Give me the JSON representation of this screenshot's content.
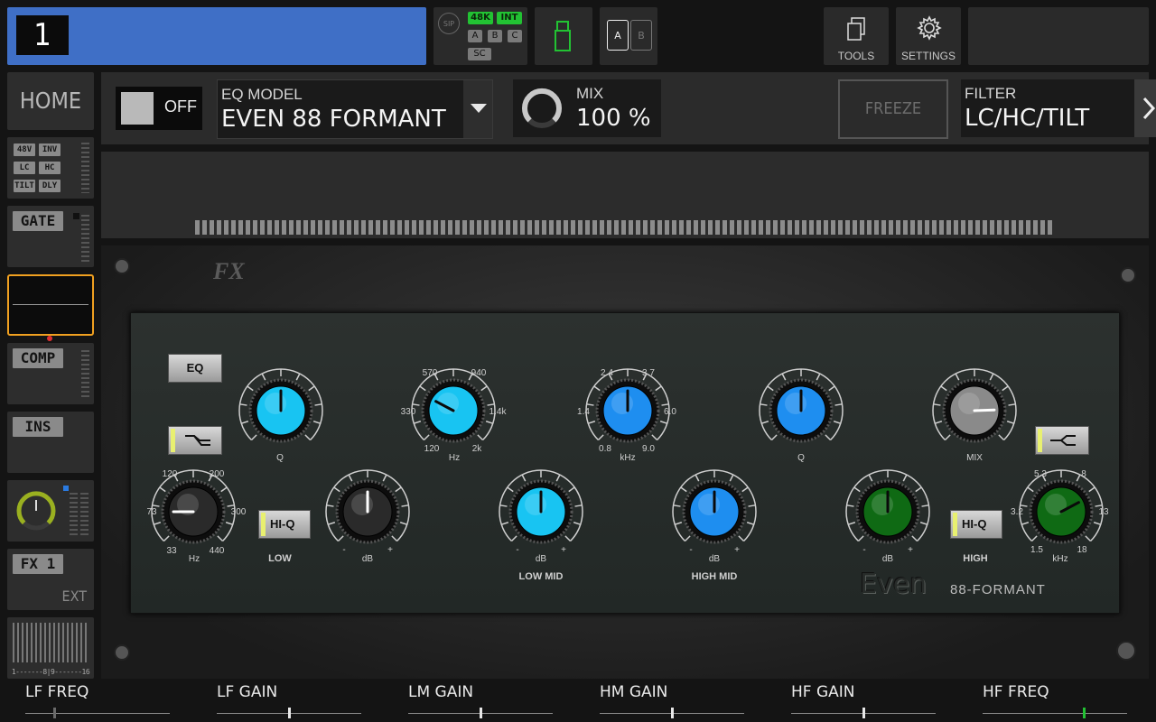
{
  "topbar": {
    "channel_number": "1",
    "sip_label": "SIP",
    "tags": {
      "sr": "48K",
      "clock": "INT",
      "a": "A",
      "b": "B",
      "c": "C",
      "sc": "SC"
    },
    "ab_a": "A",
    "ab_b": "B",
    "tools_label": "TOOLS",
    "settings_label": "SETTINGS"
  },
  "sidebar": {
    "home_label": "HOME",
    "config_tags": [
      "48V",
      "INV",
      "LC",
      "HC",
      "TILT",
      "DLY"
    ],
    "gate_label": "GATE",
    "comp_label": "COMP",
    "ins_label": "INS",
    "fx_label": "FX 1",
    "fx_sub": "EXT",
    "meter_scale": "1-------8|9-------16"
  },
  "header": {
    "on_off_label": "OFF",
    "eq_model_label": "EQ MODEL",
    "eq_model_value": "EVEN 88 FORMANT",
    "mix_label": "MIX",
    "mix_value": "100 %",
    "mix_level": 1.0,
    "freeze_label": "FREEZE",
    "filter_label": "FILTER",
    "filter_value": "LC/HC/TILT"
  },
  "plugin": {
    "logo": "FX",
    "brand": "Even",
    "model": "88-FORMANT",
    "eq_button": "EQ",
    "hiq_label": "HI-Q",
    "low_freq_ticks": [
      "120",
      "200",
      "73",
      "300",
      "33",
      "440"
    ],
    "unit_hz": "Hz",
    "unit_db": "dB",
    "unit_khz": "kHz",
    "unit_q": "Q",
    "lowmid_freq_ticks": [
      "570",
      "940",
      "330",
      "1.4k",
      "120",
      "2k"
    ],
    "himid_freq_ticks": [
      "2.4",
      "3.7",
      "1.4",
      "6.0",
      "0.8",
      "9.0"
    ],
    "high_freq_ticks": [
      "5.3",
      "8",
      "3.2",
      "13",
      "1.5",
      "18"
    ],
    "minus": "-",
    "plus": "+",
    "low_label": "LOW",
    "low_mid_label": "LOW MID",
    "high_mid_label": "HIGH MID",
    "high_label": "HIGH",
    "mix_label": "MIX"
  },
  "bottom": {
    "faders": [
      {
        "label": "LF FREQ",
        "value": 0.2
      },
      {
        "label": "LF GAIN",
        "value": 0.5
      },
      {
        "label": "LM GAIN",
        "value": 0.5
      },
      {
        "label": "HM GAIN",
        "value": 0.5
      },
      {
        "label": "HF GAIN",
        "value": 0.5
      },
      {
        "label": "HF FREQ",
        "value": 0.7
      }
    ]
  },
  "colors": {
    "channel_blue": "#3f6fc6",
    "accent_orange": "#f0a020",
    "led_green": "#22c233",
    "knob_cyan": "#18c4f2",
    "knob_blue": "#1e8ef0",
    "knob_green": "#0f6a14"
  }
}
